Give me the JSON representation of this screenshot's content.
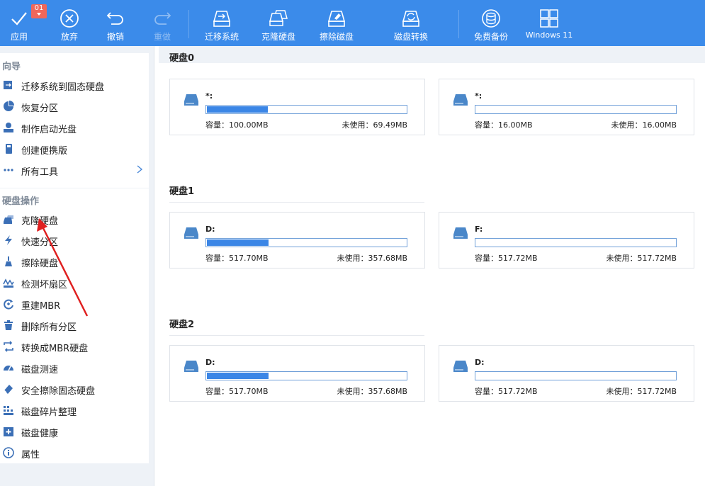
{
  "toolbar": {
    "badge": "01",
    "buttons": [
      {
        "id": "apply",
        "label": "应用",
        "icon": "check-icon"
      },
      {
        "id": "discard",
        "label": "放弃",
        "icon": "close-circle-icon"
      },
      {
        "id": "undo",
        "label": "撤销",
        "icon": "undo-icon"
      },
      {
        "id": "redo",
        "label": "重做",
        "icon": "redo-icon",
        "disabled": true
      },
      {
        "id": "migrate",
        "label": "迁移系统",
        "icon": "migrate-os-icon"
      },
      {
        "id": "clone",
        "label": "克隆硬盘",
        "icon": "clone-disk-icon"
      },
      {
        "id": "wipe",
        "label": "擦除磁盘",
        "icon": "wipe-disk-icon"
      },
      {
        "id": "convert",
        "label": "磁盘转换",
        "icon": "disk-convert-icon"
      },
      {
        "id": "backup",
        "label": "免费备份",
        "icon": "backup-icon"
      },
      {
        "id": "win11",
        "label": "Windows 11",
        "icon": "windows-icon"
      }
    ]
  },
  "sidebar": {
    "wizard": {
      "title": "向导",
      "items": [
        {
          "label": "迁移系统到固态硬盘",
          "icon": "migrate-ssd-icon"
        },
        {
          "label": "恢复分区",
          "icon": "recover-partition-icon"
        },
        {
          "label": "制作启动光盘",
          "icon": "bootable-media-icon"
        },
        {
          "label": "创建便携版",
          "icon": "portable-icon"
        },
        {
          "label": "所有工具",
          "icon": "more-icon"
        }
      ]
    },
    "disk_ops": {
      "title": "硬盘操作",
      "items": [
        {
          "label": "克隆硬盘",
          "icon": "clone-disk-icon"
        },
        {
          "label": "快速分区",
          "icon": "quick-partition-icon"
        },
        {
          "label": "擦除硬盘",
          "icon": "wipe-icon"
        },
        {
          "label": "检测坏扇区",
          "icon": "bad-sector-icon"
        },
        {
          "label": "重建MBR",
          "icon": "rebuild-mbr-icon"
        },
        {
          "label": "删除所有分区",
          "icon": "delete-partitions-icon"
        },
        {
          "label": "转换成MBR硬盘",
          "icon": "convert-mbr-icon"
        },
        {
          "label": "磁盘测速",
          "icon": "disk-speed-icon"
        },
        {
          "label": "安全擦除固态硬盘",
          "icon": "secure-erase-icon"
        },
        {
          "label": "磁盘碎片整理",
          "icon": "defrag-icon"
        },
        {
          "label": "磁盘健康",
          "icon": "disk-health-icon"
        },
        {
          "label": "属性",
          "icon": "info-icon"
        }
      ]
    }
  },
  "annotation": {
    "color": "#e02020",
    "label": "red-arrow"
  },
  "disks": [
    {
      "title": "硬盘0",
      "partitions": [
        {
          "name": "*:",
          "used_fraction": 0.305,
          "capacity": "容量：100.00MB",
          "unused": "未使用：69.49MB"
        },
        {
          "name": "*:",
          "used_fraction": 0.0,
          "capacity": "容量：16.00MB",
          "unused": "未使用：16.00MB"
        }
      ]
    },
    {
      "title": "硬盘1",
      "partitions": [
        {
          "name": "D:",
          "used_fraction": 0.309,
          "capacity": "容量：517.70MB",
          "unused": "未使用：357.68MB"
        },
        {
          "name": "F:",
          "used_fraction": 0.0,
          "capacity": "容量：517.72MB",
          "unused": "未使用：517.72MB"
        }
      ]
    },
    {
      "title": "硬盘2",
      "partitions": [
        {
          "name": "D:",
          "used_fraction": 0.309,
          "capacity": "容量：517.70MB",
          "unused": "未使用：357.68MB"
        },
        {
          "name": "D:",
          "used_fraction": 0.0,
          "capacity": "容量：517.72MB",
          "unused": "未使用：517.72MB"
        }
      ]
    }
  ],
  "colors": {
    "toolbar_bg": "#3b8bea",
    "accent": "#3b86e6",
    "arrow": "#e02020"
  }
}
